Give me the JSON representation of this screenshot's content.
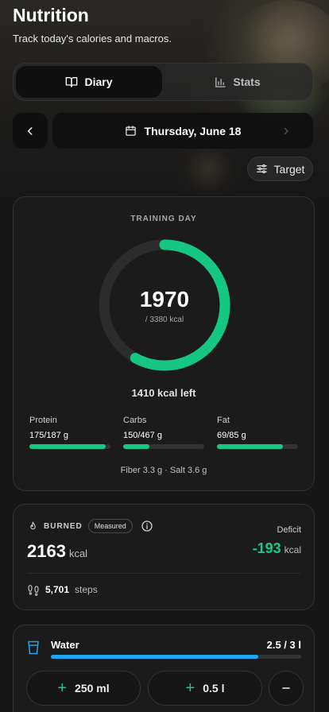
{
  "header": {
    "title": "Nutrition",
    "subtitle": "Track today's calories and macros."
  },
  "tabs": [
    {
      "label": "Diary",
      "icon": "book-icon",
      "active": true
    },
    {
      "label": "Stats",
      "icon": "bar-chart-icon",
      "active": false
    }
  ],
  "date_nav": {
    "date": "Thursday, June 18",
    "prev_icon": "chevron-left-icon",
    "next_icon": "chevron-right-icon",
    "calendar_icon": "calendar-icon"
  },
  "target_button": {
    "label": "Target",
    "icon": "sliders-icon"
  },
  "summary": {
    "day_type": "TRAINING DAY",
    "calories": "1970",
    "goal": "/ 3380 kcal",
    "progress": 0.58,
    "left_text": "1410 kcal left",
    "accent": "#16c784",
    "macros": [
      {
        "name": "Protein",
        "value": "175/187 g",
        "fraction": 0.94
      },
      {
        "name": "Carbs",
        "value": "150/467 g",
        "fraction": 0.32
      },
      {
        "name": "Fat",
        "value": "69/85 g",
        "fraction": 0.81
      }
    ],
    "extras": "Fiber 3.3 g · Salt 3.6 g"
  },
  "burned": {
    "label": "BURNED",
    "badge": "Measured",
    "value": "2163",
    "unit": "kcal",
    "deficit_label": "Deficit",
    "deficit_value": "-193",
    "deficit_unit": "kcal",
    "steps_value": "5,701",
    "steps_unit": "steps"
  },
  "water": {
    "title": "Water",
    "amount": "2.5 / 3 l",
    "fraction": 0.83,
    "color": "#1ea6f0",
    "buttons": [
      {
        "label": "250 ml"
      },
      {
        "label": "0.5 l"
      }
    ]
  }
}
